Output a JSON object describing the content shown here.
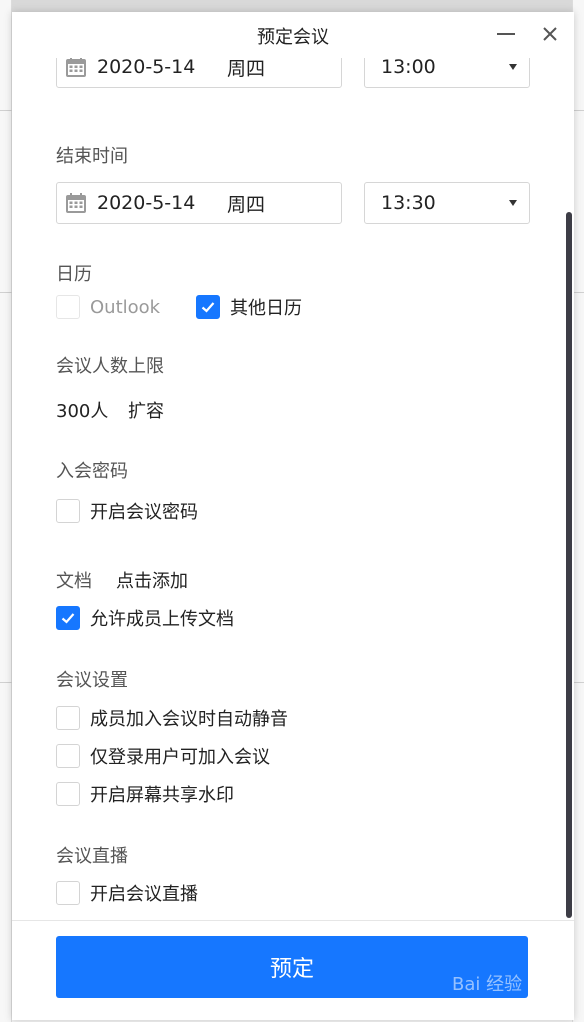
{
  "dialog": {
    "title": "预定会议"
  },
  "start": {
    "date": "2020-5-14",
    "weekday": "周四",
    "time": "13:00"
  },
  "end": {
    "label": "结束时间",
    "date": "2020-5-14",
    "weekday": "周四",
    "time": "13:30"
  },
  "calendar": {
    "label": "日历",
    "outlook_label": "Outlook",
    "other_label": "其他日历"
  },
  "capacity": {
    "label": "会议人数上限",
    "value": "300人",
    "expand_link": "扩容"
  },
  "password": {
    "label": "入会密码",
    "enable_label": "开启会议密码"
  },
  "docs": {
    "label": "文档",
    "add_link": "点击添加",
    "allow_upload_label": "允许成员上传文档"
  },
  "settings": {
    "label": "会议设置",
    "mute_label": "成员加入会议时自动静音",
    "login_only_label": "仅登录用户可加入会议",
    "watermark_label": "开启屏幕共享水印"
  },
  "live": {
    "label": "会议直播",
    "enable_label": "开启会议直播"
  },
  "footer": {
    "submit_label": "预定"
  },
  "watermark": "Bai 经验",
  "colors": {
    "accent": "#1677ff",
    "link": "#1a73e8"
  },
  "icons": {
    "calendar": "calendar-icon",
    "close": "close-icon",
    "minimize": "minimize-icon",
    "dropdown": "chevron-down-icon",
    "check": "checkmark-icon"
  }
}
